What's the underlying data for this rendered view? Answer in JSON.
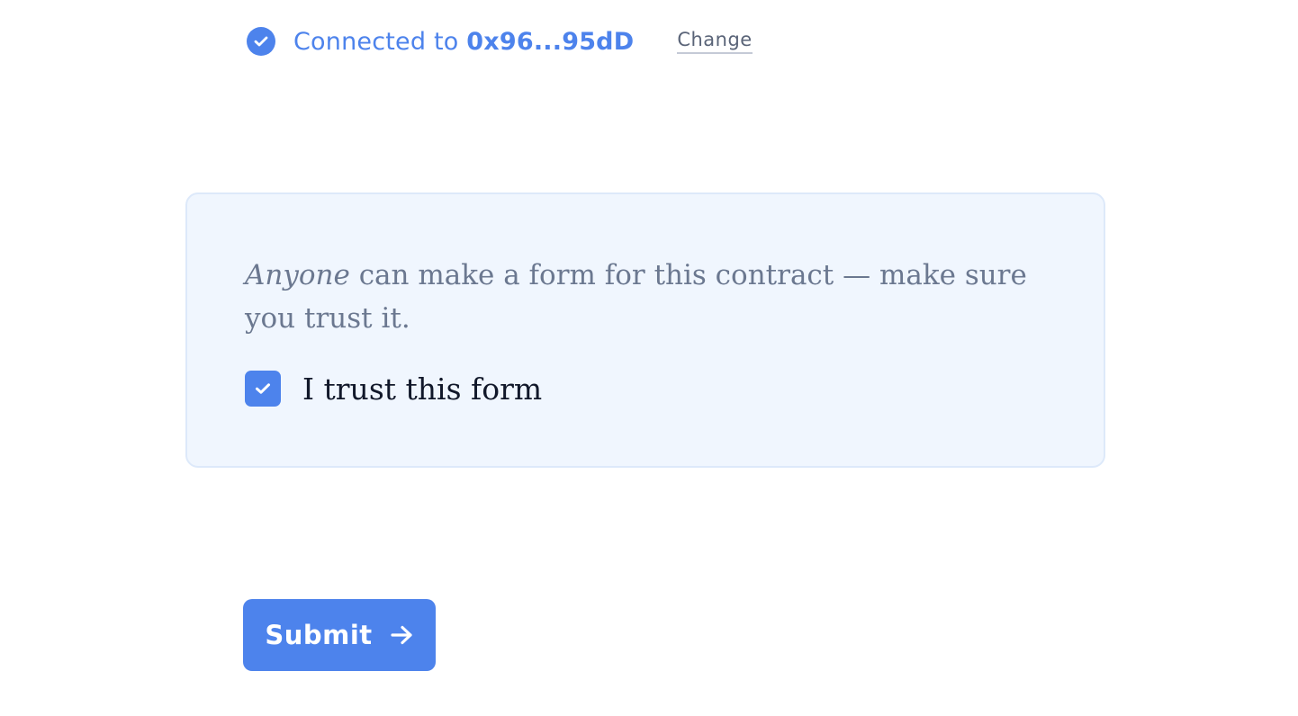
{
  "colors": {
    "accent": "#4d83ec",
    "box_background": "#f0f6fe",
    "muted_text": "#6b7890"
  },
  "connection": {
    "icon": "check-circle-icon",
    "prefix": "Connected to ",
    "address": "0x96...95dD",
    "change_label": "Change"
  },
  "trust": {
    "warning_emphasis": "Anyone",
    "warning_rest": " can make a form for this contract — make sure you trust it.",
    "checkbox_checked": true,
    "checkbox_icon": "checkmark-icon",
    "checkbox_label": "I trust this form"
  },
  "submit": {
    "label": "Submit",
    "icon": "arrow-right-icon"
  }
}
